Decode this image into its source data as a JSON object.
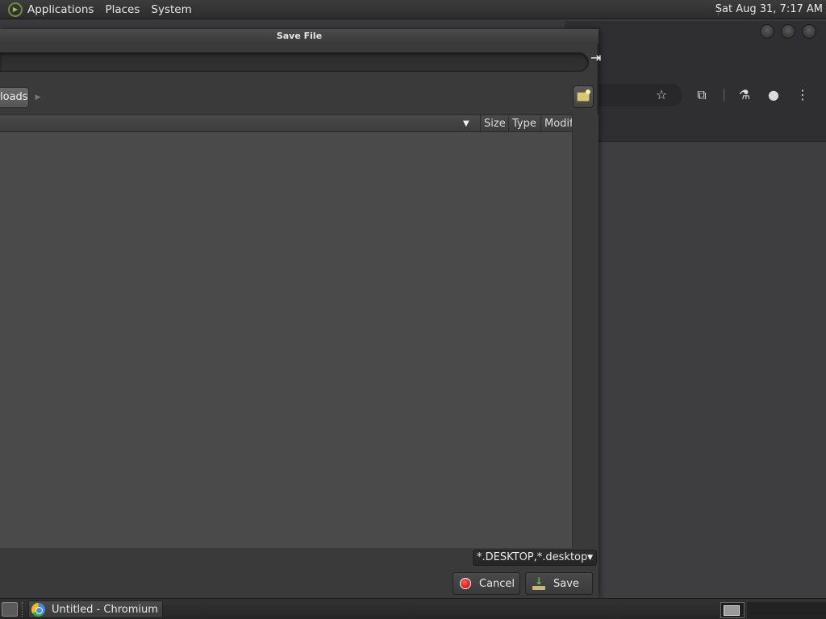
{
  "top_panel": {
    "menus": [
      "Applications",
      "Places",
      "System"
    ],
    "clock": "Sat Aug 31,  7:17 AM"
  },
  "dialog": {
    "title": "Save File",
    "name_value": "",
    "path_button": "loads",
    "columns": {
      "size": "Size",
      "type": "Type",
      "modified": "Modif"
    },
    "filter": "*.DESKTOP,*.desktop",
    "cancel_label": "Cancel",
    "save_label": "Save"
  },
  "taskbar": {
    "items": [
      {
        "label": "Untitled - Chromium",
        "icon": "chromium-icon"
      }
    ]
  },
  "browser_toolbar_icons": [
    "star-icon",
    "extensions-icon",
    "labs-flask-icon",
    "profile-icon",
    "more-menu-icon"
  ],
  "colors": {
    "dialog_bg": "#3a3a3a",
    "file_list_bg": "#4a4a4a",
    "cancel_icon": "#e00000",
    "save_icon_arrow": "#5fc24a"
  }
}
